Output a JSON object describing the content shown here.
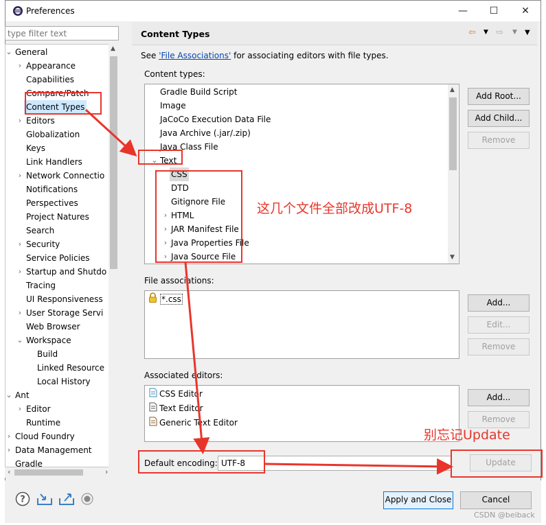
{
  "window": {
    "title": "Preferences",
    "controls": {
      "minimize": "—",
      "maximize": "☐",
      "close": "✕"
    }
  },
  "filter": {
    "placeholder": "type filter text"
  },
  "tree": [
    {
      "label": "General",
      "level": 0,
      "expander": "expanded"
    },
    {
      "label": "Appearance",
      "level": 1,
      "expander": "collapsed"
    },
    {
      "label": "Capabilities",
      "level": 1,
      "expander": "none"
    },
    {
      "label": "Compare/Patch",
      "level": 1,
      "expander": "none"
    },
    {
      "label": "Content Types",
      "level": 1,
      "expander": "none",
      "selected": true
    },
    {
      "label": "Editors",
      "level": 1,
      "expander": "collapsed"
    },
    {
      "label": "Globalization",
      "level": 1,
      "expander": "none"
    },
    {
      "label": "Keys",
      "level": 1,
      "expander": "none"
    },
    {
      "label": "Link Handlers",
      "level": 1,
      "expander": "none"
    },
    {
      "label": "Network Connectio",
      "level": 1,
      "expander": "collapsed"
    },
    {
      "label": "Notifications",
      "level": 1,
      "expander": "none"
    },
    {
      "label": "Perspectives",
      "level": 1,
      "expander": "none"
    },
    {
      "label": "Project Natures",
      "level": 1,
      "expander": "none"
    },
    {
      "label": "Search",
      "level": 1,
      "expander": "none"
    },
    {
      "label": "Security",
      "level": 1,
      "expander": "collapsed"
    },
    {
      "label": "Service Policies",
      "level": 1,
      "expander": "none"
    },
    {
      "label": "Startup and Shutdo",
      "level": 1,
      "expander": "collapsed"
    },
    {
      "label": "Tracing",
      "level": 1,
      "expander": "none"
    },
    {
      "label": "UI Responsiveness",
      "level": 1,
      "expander": "none"
    },
    {
      "label": "User Storage Servi",
      "level": 1,
      "expander": "collapsed"
    },
    {
      "label": "Web Browser",
      "level": 1,
      "expander": "none"
    },
    {
      "label": "Workspace",
      "level": 1,
      "expander": "expanded"
    },
    {
      "label": "Build",
      "level": 2,
      "expander": "none"
    },
    {
      "label": "Linked Resource",
      "level": 2,
      "expander": "none"
    },
    {
      "label": "Local History",
      "level": 2,
      "expander": "none"
    },
    {
      "label": "Ant",
      "level": 0,
      "expander": "expanded"
    },
    {
      "label": "Editor",
      "level": 1,
      "expander": "collapsed"
    },
    {
      "label": "Runtime",
      "level": 1,
      "expander": "none"
    },
    {
      "label": "Cloud Foundry",
      "level": 0,
      "expander": "collapsed"
    },
    {
      "label": "Data Management",
      "level": 0,
      "expander": "collapsed"
    },
    {
      "label": "Gradle",
      "level": 0,
      "expander": "none"
    }
  ],
  "page": {
    "title": "Content Types",
    "see_prefix": "See ",
    "see_link": "'File Associations'",
    "see_suffix": " for associating editors with file types.",
    "content_types_label": "Content types:",
    "file_assoc_label": "File associations:",
    "assoc_editors_label": "Associated editors:",
    "default_encoding_label": "Default encoding:",
    "default_encoding_value": "UTF-8"
  },
  "content_types": [
    {
      "label": "Gradle Build Script",
      "level": 0,
      "expander": "none"
    },
    {
      "label": "Image",
      "level": 0,
      "expander": "none"
    },
    {
      "label": "JaCoCo Execution Data File",
      "level": 0,
      "expander": "none"
    },
    {
      "label": "Java Archive (.jar/.zip)",
      "level": 0,
      "expander": "none"
    },
    {
      "label": "Java Class File",
      "level": 0,
      "expander": "none"
    },
    {
      "label": "Text",
      "level": 0,
      "expander": "expanded"
    },
    {
      "label": "CSS",
      "level": 1,
      "expander": "none",
      "selected": true
    },
    {
      "label": "DTD",
      "level": 1,
      "expander": "none"
    },
    {
      "label": "Gitignore File",
      "level": 1,
      "expander": "none"
    },
    {
      "label": "HTML",
      "level": 1,
      "expander": "collapsed"
    },
    {
      "label": "JAR Manifest File",
      "level": 1,
      "expander": "collapsed"
    },
    {
      "label": "Java Properties File",
      "level": 1,
      "expander": "collapsed"
    },
    {
      "label": "Java Source File",
      "level": 1,
      "expander": "collapsed"
    }
  ],
  "content_type_buttons": {
    "add_root": "Add Root...",
    "add_child": "Add Child...",
    "remove": "Remove"
  },
  "file_associations": [
    {
      "label": "*.css",
      "icon": "lock-icon"
    }
  ],
  "file_assoc_buttons": {
    "add": "Add...",
    "edit": "Edit...",
    "remove": "Remove"
  },
  "associated_editors": [
    {
      "label": "CSS Editor",
      "icon": "css-editor-icon"
    },
    {
      "label": "Text Editor",
      "icon": "text-editor-icon"
    },
    {
      "label": "Generic Text Editor",
      "icon": "generic-editor-icon"
    }
  ],
  "editor_buttons": {
    "add": "Add...",
    "remove": "Remove"
  },
  "update_button": "Update",
  "bottom": {
    "apply_close": "Apply and Close",
    "cancel": "Cancel"
  },
  "annotations": {
    "note_files": "这几个文件全部改成UTF-8",
    "note_update": "别忘记Update",
    "watermark": "CSDN @beiback"
  },
  "colors": {
    "annotation": "#e8352b",
    "link": "#0645ad",
    "accent_border": "#0078d7"
  }
}
